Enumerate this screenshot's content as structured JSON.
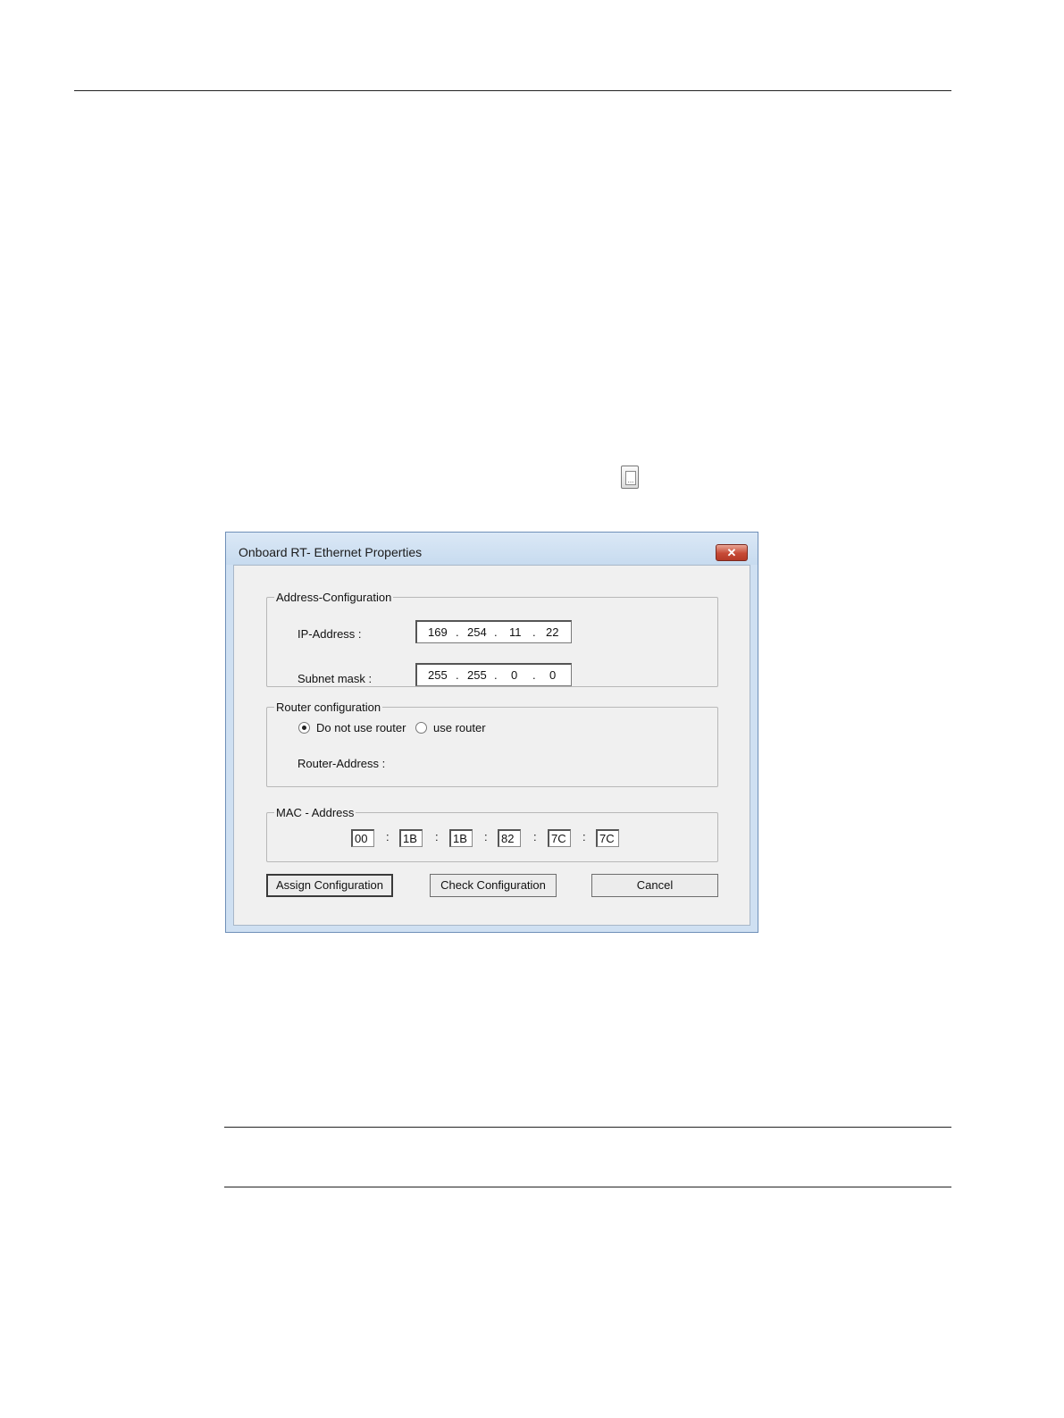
{
  "dialog": {
    "title": "Onboard RT- Ethernet Properties",
    "close_symbol": "✕",
    "address_group": {
      "legend": "Address-Configuration",
      "ip_label": "IP-Address :",
      "ip_octets": [
        "169",
        "254",
        "11",
        "22"
      ],
      "subnet_label": "Subnet mask :",
      "subnet_octets": [
        "255",
        "255",
        "0",
        "0"
      ],
      "separator": "."
    },
    "router_group": {
      "legend": "Router configuration",
      "option_no_router": "Do not use router",
      "option_use_router": "use router",
      "selected": "Do not use router",
      "router_address_label": "Router-Address :"
    },
    "mac_group": {
      "legend": "MAC - Address",
      "bytes": [
        "00",
        "1B",
        "1B",
        "82",
        "7C",
        "7C"
      ],
      "separator": ":"
    },
    "buttons": {
      "assign": "Assign Configuration",
      "check": "Check Configuration",
      "cancel": "Cancel"
    }
  },
  "inline_icon": {
    "glyph": "...",
    "icon": "browse-button-icon"
  }
}
